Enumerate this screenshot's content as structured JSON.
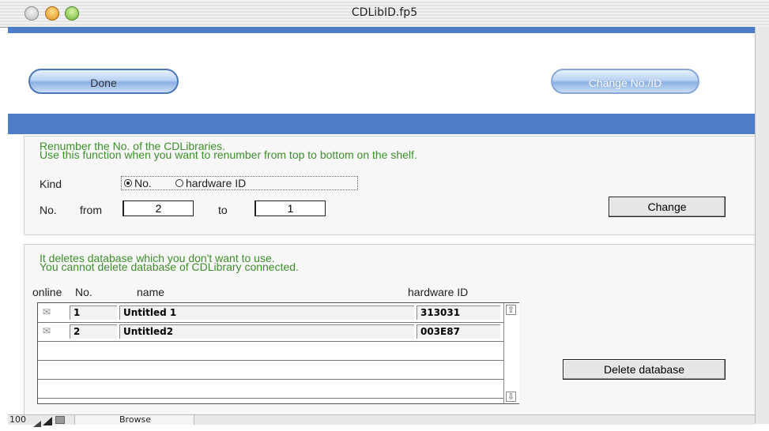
{
  "window": {
    "title": "CDLibID.fp5"
  },
  "header": {
    "done_label": "Done",
    "change_no_id_label": "Change No./ID"
  },
  "renumber": {
    "line1": "Renumber the No. of the CDLibraries.",
    "line2": "Use this function when you want to renumber from top to bottom on the shelf.",
    "kind_label": "Kind",
    "kind_options": [
      "No.",
      "hardware ID"
    ],
    "kind_selected": "No.",
    "no_label": "No.",
    "from_label": "from",
    "from_value": "2",
    "to_label": "to",
    "to_value": "1",
    "change_label": "Change"
  },
  "delete": {
    "line1": "It deletes database which you don't want to use.",
    "line2": "You cannot delete database of CDLibrary connected.",
    "columns": {
      "online": "online",
      "no": "No.",
      "name": "name",
      "hardware_id": "hardware ID"
    },
    "rows": [
      {
        "no": "1",
        "name": "Untitled 1",
        "hardware_id": "313031"
      },
      {
        "no": "2",
        "name": "Untitled2",
        "hardware_id": "003E87"
      }
    ],
    "delete_label": "Delete database"
  },
  "statusbar": {
    "zoom": "100",
    "mode": "Browse"
  },
  "icons": [
    "mail-icon",
    "scroll-up-arrow-icon",
    "scroll-down-arrow-icon",
    "zoom-out-icon",
    "zoom-in-icon",
    "status-toggle-icon"
  ]
}
